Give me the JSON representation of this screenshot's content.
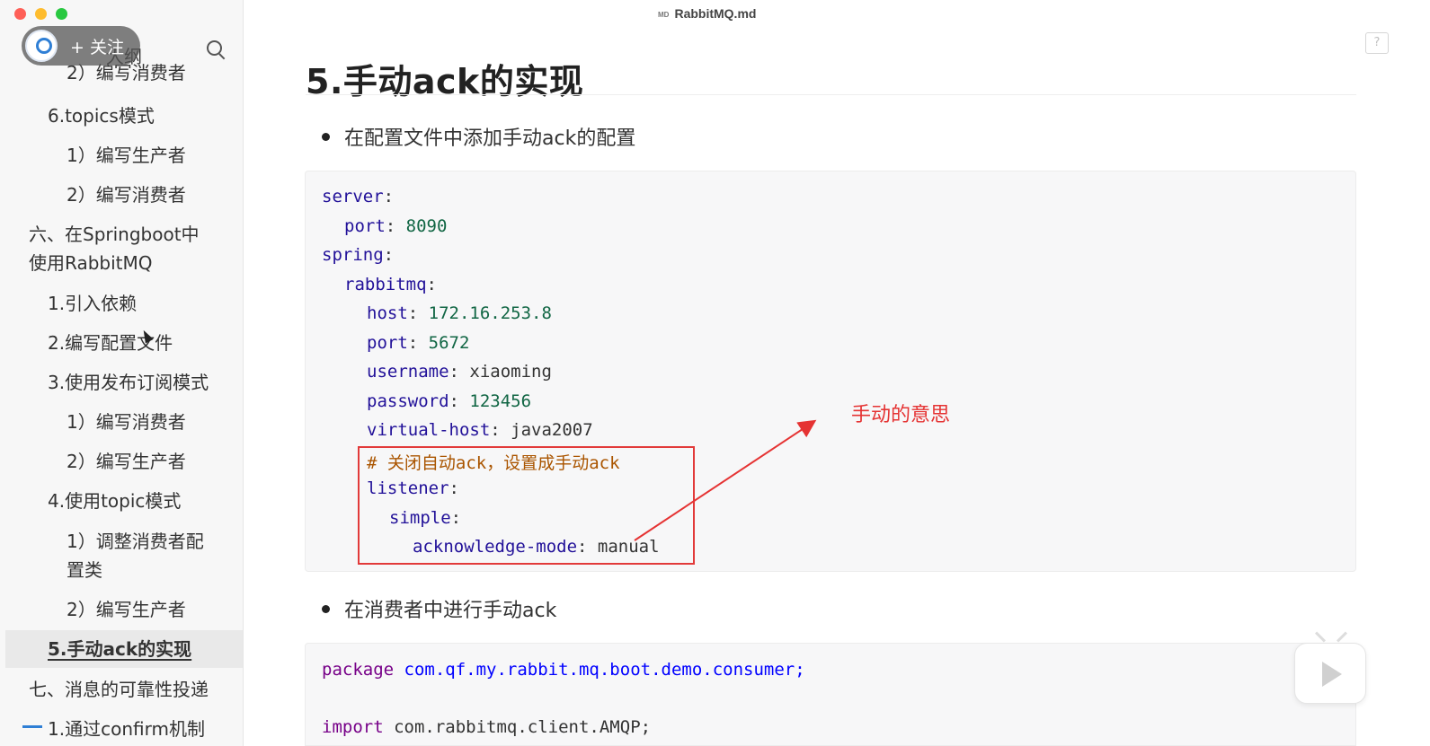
{
  "window": {
    "title": "RabbitMQ.md",
    "md_badge": "MD"
  },
  "sidebar": {
    "follow_button": "+ 关注",
    "outline_label": "大纲",
    "items": [
      "2）编写消费者",
      "6.topics模式",
      "1）编写生产者",
      "2）编写消费者",
      "六、在Springboot中使用RabbitMQ",
      "1.引入依赖",
      "2.编写配置文件",
      "3.使用发布订阅模式",
      "1）编写消费者",
      "2）编写生产者",
      "4.使用topic模式",
      "1）调整消费者配置类",
      "2）编写生产者",
      "5.手动ack的实现",
      "七、消息的可靠性投递",
      "1.通过confirm机制"
    ],
    "active_item": "5.手动ack的实现"
  },
  "main": {
    "heading": "5.手动ack的实现",
    "bullet1": "在配置文件中添加手动ack的配置",
    "bullet2": "在消费者中进行手动ack",
    "yaml": {
      "server": "server",
      "port_key": "port",
      "port_val": "8090",
      "spring": "spring",
      "rabbitmq": "rabbitmq",
      "host_key": "host",
      "host_val": "172.16.253.8",
      "rport_key": "port",
      "rport_val": "5672",
      "user_key": "username",
      "user_val": "xiaoming",
      "pass_key": "password",
      "pass_val": "123456",
      "vhost_key": "virtual-host",
      "vhost_val": "java2007",
      "comment": "# 关闭自动ack，设置成手动ack",
      "listener": "listener",
      "simple": "simple",
      "ack_key": "acknowledge-mode",
      "ack_val": "manual"
    },
    "java": {
      "package_kw": "package",
      "package_name": "com.qf.my.rabbit.mq.boot.demo.consumer;",
      "import_kw": "import",
      "import_name": "com.rabbitmq.client.AMQP;"
    },
    "annotation": "手动的意思",
    "help_icon": "?"
  },
  "colors": {
    "annotation_red": "#e53333",
    "yaml_key": "#221199",
    "yaml_number": "#116644",
    "comment": "#aa5500"
  }
}
